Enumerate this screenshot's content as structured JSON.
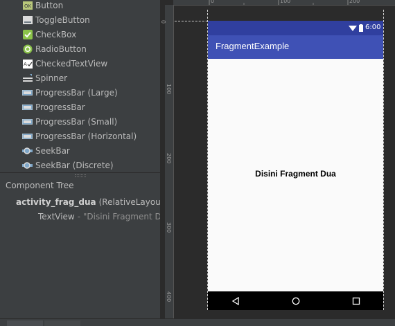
{
  "palette": {
    "items": [
      {
        "label": "Button",
        "icon": "ok-button-icon"
      },
      {
        "label": "ToggleButton",
        "icon": "toggle-button-icon"
      },
      {
        "label": "CheckBox",
        "icon": "checkbox-checked-icon"
      },
      {
        "label": "RadioButton",
        "icon": "radio-button-icon"
      },
      {
        "label": "CheckedTextView",
        "icon": "checked-text-view-icon"
      },
      {
        "label": "Spinner",
        "icon": "spinner-icon"
      },
      {
        "label": "ProgressBar (Large)",
        "icon": "progressbar-icon"
      },
      {
        "label": "ProgressBar",
        "icon": "progressbar-icon"
      },
      {
        "label": "ProgressBar (Small)",
        "icon": "progressbar-icon"
      },
      {
        "label": "ProgressBar (Horizontal)",
        "icon": "progressbar-icon"
      },
      {
        "label": "SeekBar",
        "icon": "seekbar-icon"
      },
      {
        "label": "SeekBar (Discrete)",
        "icon": "seekbar-icon"
      }
    ]
  },
  "component_tree": {
    "header": "Component Tree",
    "root_name": "activity_frag_dua",
    "root_type": "(RelativeLayout",
    "child_name": "TextView",
    "child_detail": "- \"Disini Fragment D"
  },
  "rulers": {
    "top_ticks": [
      "0",
      "100",
      "200"
    ],
    "left_ticks": [
      "0",
      "100",
      "200",
      "300",
      "400"
    ]
  },
  "device": {
    "time": "6:00",
    "app_title": "FragmentExample",
    "content_text": "Disini Fragment Dua"
  },
  "colors": {
    "status_bar": "#303f9f",
    "app_bar": "#3f51b5",
    "content_bg": "#fafafa",
    "panel_bg": "#3c3f41",
    "canvas_bg": "#2b2b2b"
  }
}
